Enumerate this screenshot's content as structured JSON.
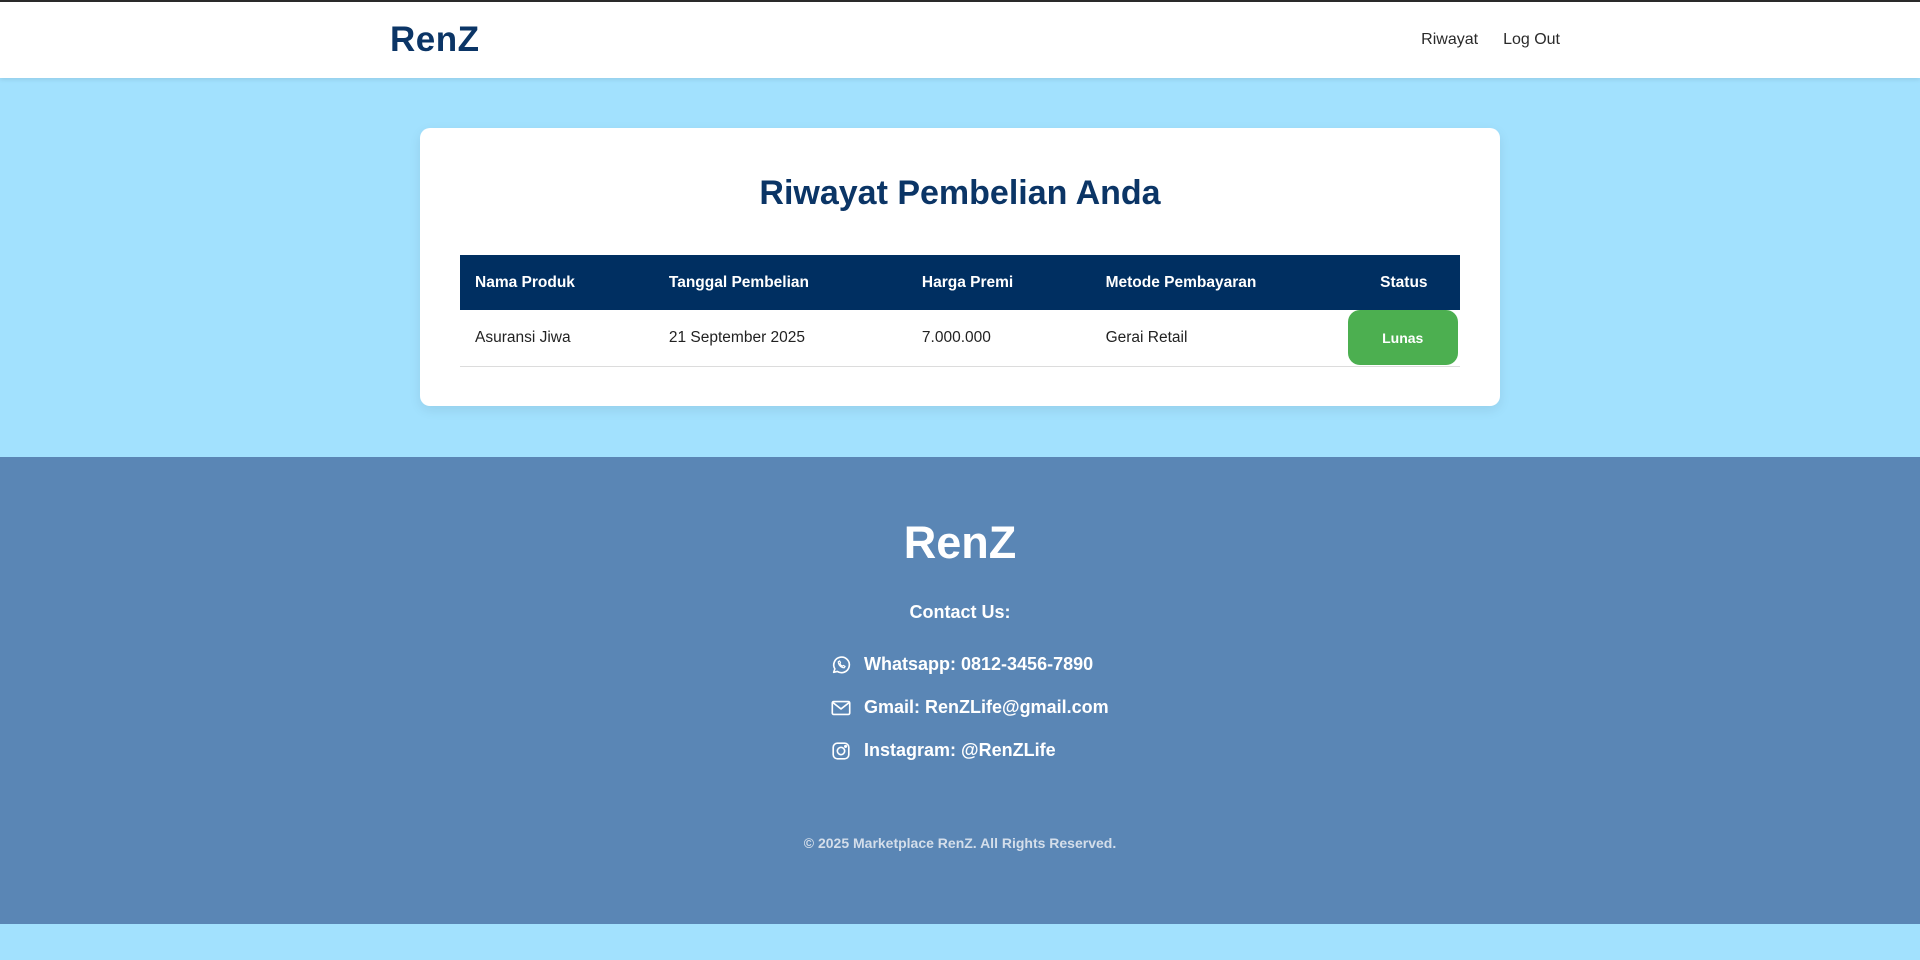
{
  "header": {
    "brand": "RenZ",
    "nav": {
      "history_label": "Riwayat",
      "logout_label": "Log Out"
    }
  },
  "main": {
    "title": "Riwayat Pembelian Anda",
    "table": {
      "columns": [
        "Nama Produk",
        "Tanggal Pembelian",
        "Harga Premi",
        "Metode Pembayaran",
        "Status"
      ],
      "rows": [
        {
          "product": "Asuransi Jiwa",
          "date": "21 September 2025",
          "premium": "7.000.000",
          "payment_method": "Gerai Retail",
          "status": "Lunas"
        }
      ]
    }
  },
  "footer": {
    "brand": "RenZ",
    "contact_title": "Contact Us:",
    "contacts": [
      {
        "icon": "whatsapp-icon",
        "text": "Whatsapp: 0812-3456-7890"
      },
      {
        "icon": "mail-icon",
        "text": "Gmail: RenZLife@gmail.com"
      },
      {
        "icon": "instagram-icon",
        "text": "Instagram: @RenZLife"
      }
    ],
    "copyright": "© 2025 Marketplace RenZ. All Rights Reserved."
  },
  "colors": {
    "page_bg": "#a2e1fe",
    "brand_navy": "#0b3566",
    "table_header": "#002f61",
    "status_paid": "#4caf50",
    "footer_bg": "#5a86b5"
  }
}
